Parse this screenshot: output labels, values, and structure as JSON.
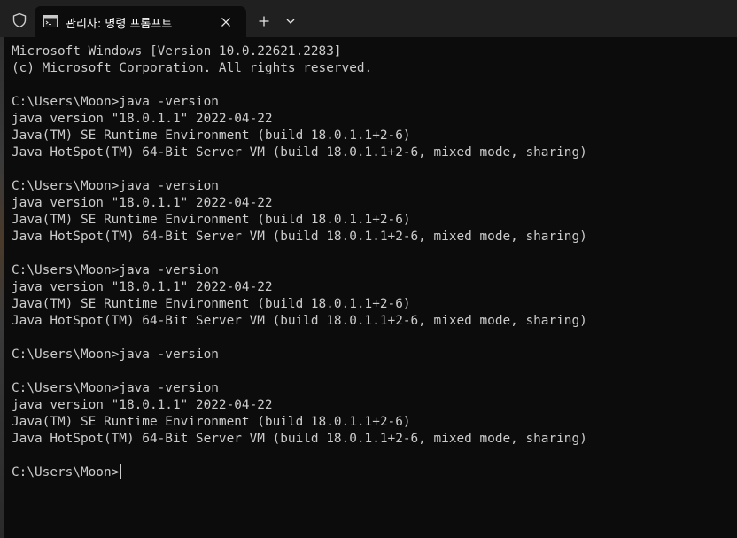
{
  "tab": {
    "title": "관리자: 명령 프롬프트",
    "icon": "command-prompt-icon",
    "close_icon": "close-icon",
    "new_tab_icon": "plus-icon",
    "dropdown_icon": "chevron-down-icon"
  },
  "console": {
    "lines": [
      "Microsoft Windows [Version 10.0.22621.2283]",
      "(c) Microsoft Corporation. All rights reserved.",
      "",
      "C:\\Users\\Moon>java -version",
      "java version \"18.0.1.1\" 2022-04-22",
      "Java(TM) SE Runtime Environment (build 18.0.1.1+2-6)",
      "Java HotSpot(TM) 64-Bit Server VM (build 18.0.1.1+2-6, mixed mode, sharing)",
      "",
      "C:\\Users\\Moon>java -version",
      "java version \"18.0.1.1\" 2022-04-22",
      "Java(TM) SE Runtime Environment (build 18.0.1.1+2-6)",
      "Java HotSpot(TM) 64-Bit Server VM (build 18.0.1.1+2-6, mixed mode, sharing)",
      "",
      "C:\\Users\\Moon>java -version",
      "java version \"18.0.1.1\" 2022-04-22",
      "Java(TM) SE Runtime Environment (build 18.0.1.1+2-6)",
      "Java HotSpot(TM) 64-Bit Server VM (build 18.0.1.1+2-6, mixed mode, sharing)",
      "",
      "C:\\Users\\Moon>java -version",
      "",
      "C:\\Users\\Moon>java -version",
      "java version \"18.0.1.1\" 2022-04-22",
      "Java(TM) SE Runtime Environment (build 18.0.1.1+2-6)",
      "Java HotSpot(TM) 64-Bit Server VM (build 18.0.1.1+2-6, mixed mode, sharing)",
      "",
      "C:\\Users\\Moon>"
    ]
  },
  "colors": {
    "background": "#0c0c0c",
    "titlebar": "#202020",
    "text": "#cccccc"
  }
}
